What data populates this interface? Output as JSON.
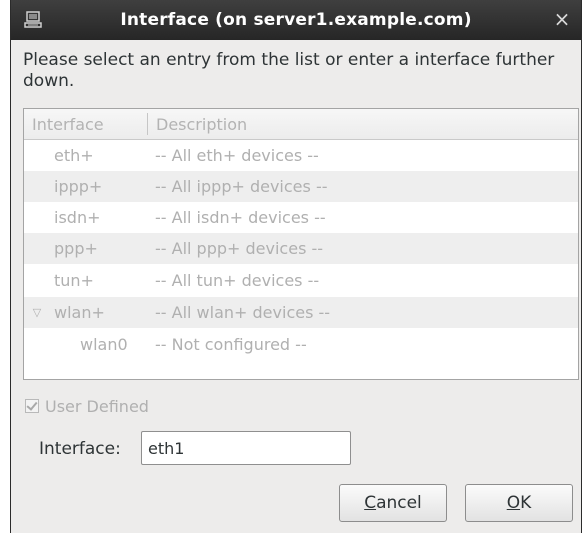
{
  "window": {
    "title": "Interface (on server1.example.com)",
    "close_glyph": "×"
  },
  "prompt": "Please select an entry from the list or enter a interface further down.",
  "list": {
    "columns": [
      "Interface",
      "Description"
    ],
    "rows": [
      {
        "name": "eth+",
        "description": "-- All eth+ devices --"
      },
      {
        "name": "ippp+",
        "description": "-- All ippp+ devices --"
      },
      {
        "name": "isdn+",
        "description": "-- All isdn+ devices --"
      },
      {
        "name": "ppp+",
        "description": "-- All ppp+ devices --"
      },
      {
        "name": "tun+",
        "description": "-- All tun+ devices --"
      },
      {
        "name": "wlan+",
        "description": "-- All wlan+ devices --",
        "expander": "▽"
      },
      {
        "name": "wlan0",
        "description": "-- Not configured --"
      }
    ]
  },
  "user_defined": {
    "label": "User Defined",
    "checked": true
  },
  "interface_field": {
    "label": "Interface:",
    "value": "eth1"
  },
  "buttons": {
    "cancel_mnemonic": "C",
    "cancel_rest": "ancel",
    "ok_mnemonic": "O",
    "ok_rest": "K"
  }
}
